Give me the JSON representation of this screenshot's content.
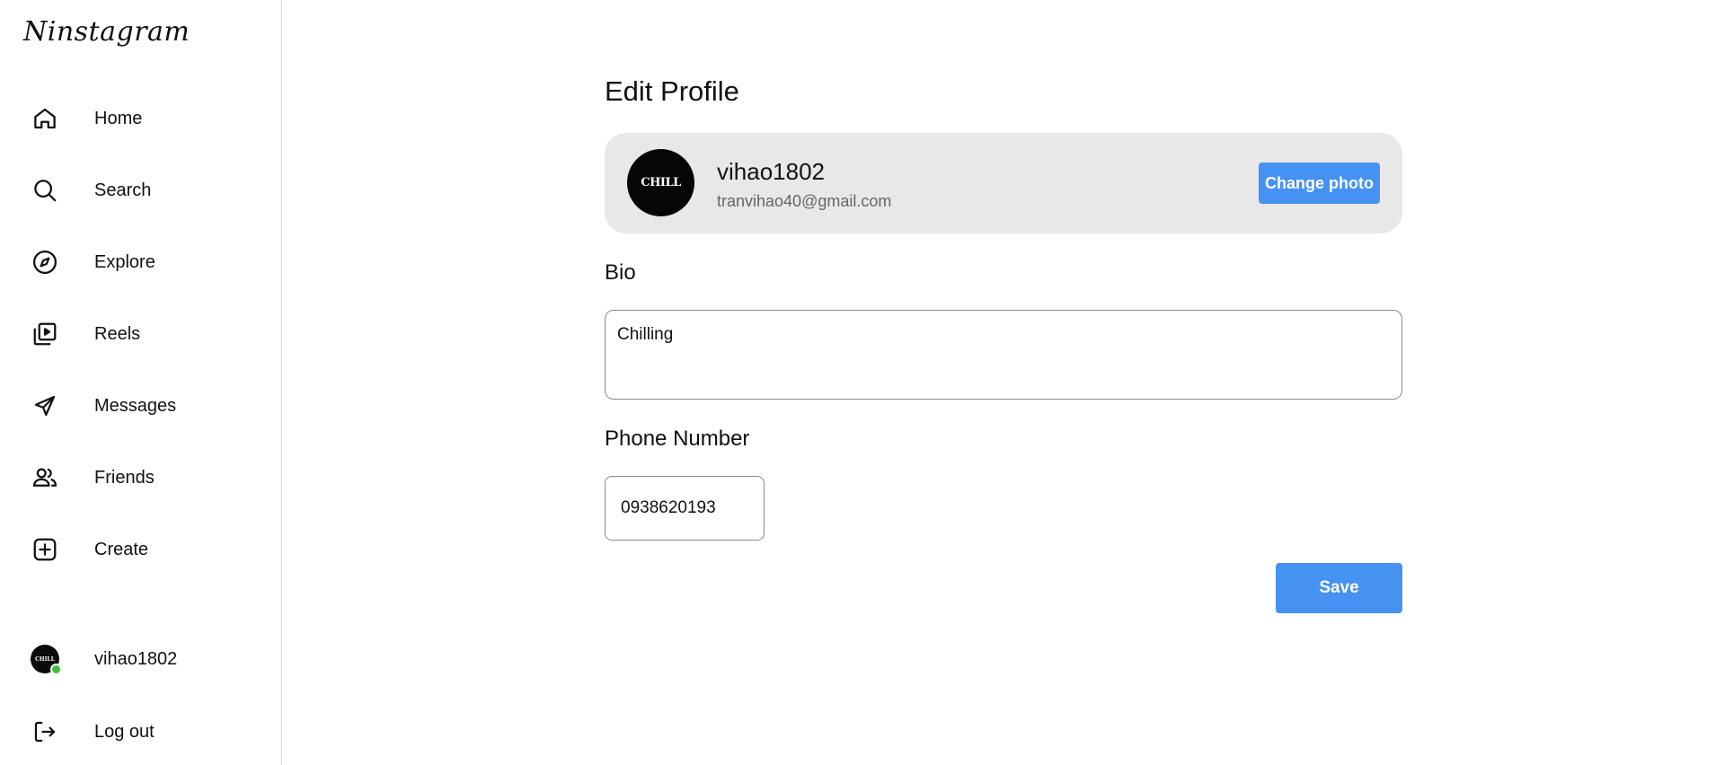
{
  "app": {
    "logo": "Ninstagram"
  },
  "sidebar": {
    "items": [
      {
        "label": "Home",
        "icon": "home-icon"
      },
      {
        "label": "Search",
        "icon": "search-icon"
      },
      {
        "label": "Explore",
        "icon": "compass-icon"
      },
      {
        "label": "Reels",
        "icon": "reels-icon"
      },
      {
        "label": "Messages",
        "icon": "send-icon"
      },
      {
        "label": "Friends",
        "icon": "friends-icon"
      },
      {
        "label": "Create",
        "icon": "plus-square-icon"
      }
    ],
    "profile": {
      "label": "vihao1802",
      "avatar_text": "CHILL",
      "status_color": "#3cc13b"
    },
    "logout": {
      "label": "Log out",
      "icon": "logout-icon"
    }
  },
  "main": {
    "title": "Edit Profile",
    "profile_card": {
      "username": "vihao1802",
      "email": "tranvihao40@gmail.com",
      "avatar_text": "CHILL",
      "change_photo_label": "Change photo"
    },
    "bio": {
      "label": "Bio",
      "value": "Chilling"
    },
    "phone": {
      "label": "Phone Number",
      "value": "0938620193"
    },
    "save_label": "Save"
  },
  "colors": {
    "accent": "#4592f2",
    "card_bg": "#e8e8e8",
    "online": "#3cc13b"
  }
}
